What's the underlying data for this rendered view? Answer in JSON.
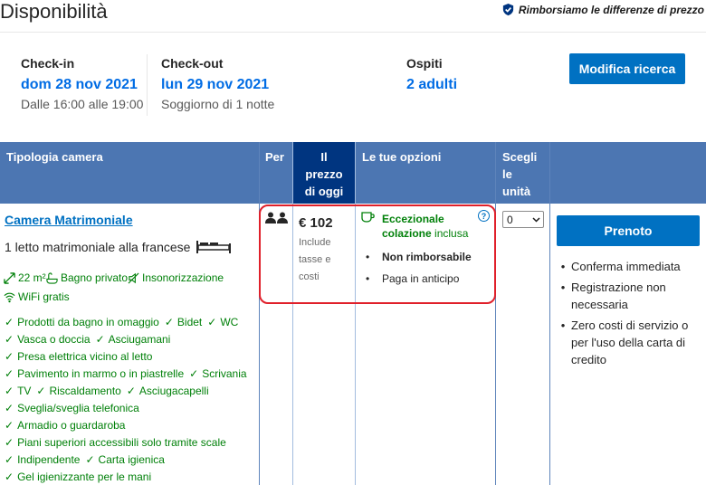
{
  "header": {
    "title": "Disponibilità",
    "price_promise": "Rimborsiamo le differenze di prezzo"
  },
  "search": {
    "checkin_label": "Check-in",
    "checkin_date": "dom 28 nov 2021",
    "checkin_time": "Dalle 16:00 alle 19:00",
    "checkout_label": "Check-out",
    "checkout_date": "lun 29 nov 2021",
    "stay_length": "Soggiorno di 1 notte",
    "guests_label": "Ospiti",
    "guests_value": "2 adulti",
    "modify_button": "Modifica ricerca"
  },
  "table": {
    "headers": {
      "room_type": "Tipologia camera",
      "per": "Per",
      "price_line1": "Il",
      "price_line2": "prezzo",
      "price_line3": "di oggi",
      "options": "Le tue opzioni",
      "select_line1": "Scegli",
      "select_line2": "le",
      "select_line3": "unità"
    },
    "room": {
      "name": "Camera Matrimoniale",
      "bed": "1 letto matrimoniale alla francese",
      "size": "22 m²",
      "private_bath": "Bagno privato",
      "soundproof": "Insonorizzazione",
      "wifi": "WiFi gratis",
      "amenity_rows": [
        [
          "Prodotti da bagno in omaggio",
          "Bidet",
          "WC"
        ],
        [
          "Vasca o doccia",
          "Asciugamani"
        ],
        [
          "Presa elettrica vicino al letto"
        ],
        [
          "Pavimento in marmo o in piastrelle",
          "Scrivania"
        ],
        [
          "TV",
          "Riscaldamento",
          "Asciugacapelli"
        ],
        [
          "Sveglia/sveglia telefonica"
        ],
        [
          "Armadio o guardaroba"
        ],
        [
          "Piani superiori accessibili solo tramite scale"
        ],
        [
          "Indipendente",
          "Carta igienica"
        ],
        [
          "Gel igienizzante per le mani"
        ]
      ],
      "price": "€ 102",
      "price_note_1": "Include",
      "price_note_2": "tasse e",
      "price_note_3": "costi",
      "option_breakfast_strong_1": "Eccezionale",
      "option_breakfast_strong_2": "colazione",
      "option_breakfast_light": "inclusa",
      "option_non_refundable": "Non rimborsabile",
      "option_prepay": "Paga in anticipo",
      "help_icon_text": "?",
      "units_selected": "0",
      "book_button": "Prenoto",
      "benefits": [
        "Conferma immediata",
        "Registrazione non necessaria",
        "Zero costi di servizio o per l'uso della carta di credito"
      ]
    }
  },
  "colors": {
    "accent": "#0071c2",
    "header_blue": "#4c76b2",
    "price_header": "#003580",
    "green": "#008009",
    "highlight": "#e0202a"
  }
}
